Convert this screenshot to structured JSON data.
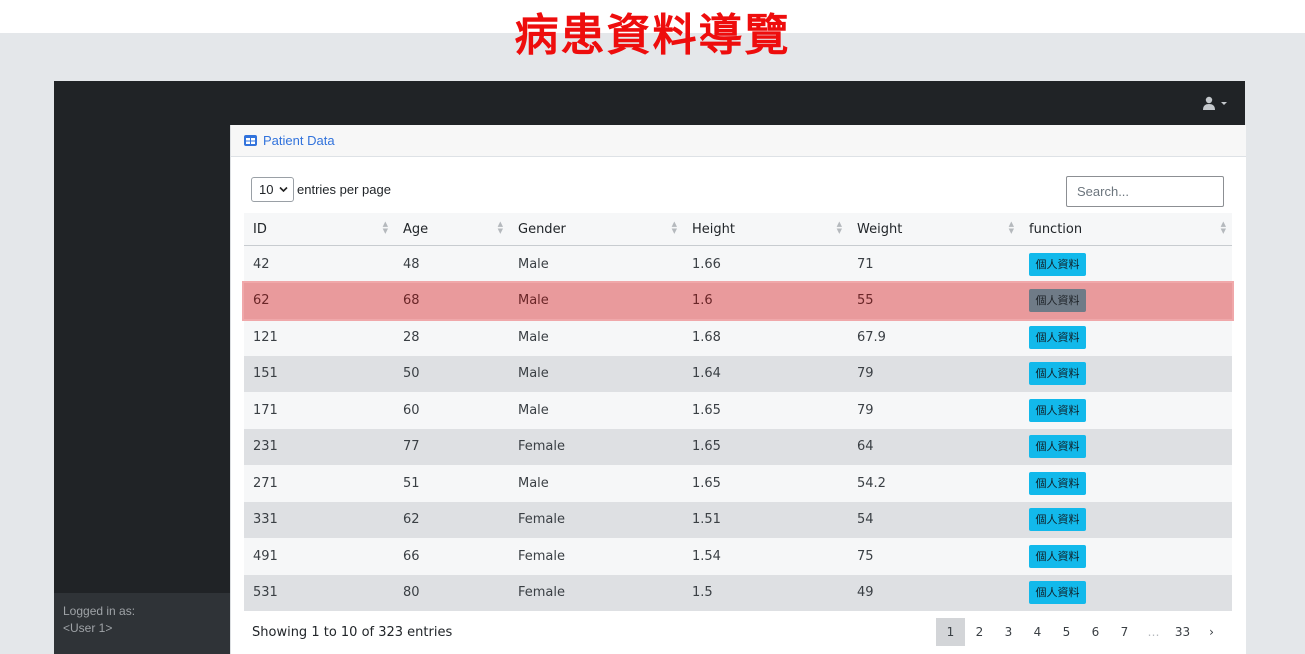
{
  "page_title": "病患資料導覽",
  "sidebar": {
    "logged_in_label": "Logged in as:",
    "user_name": "<User 1>"
  },
  "topnav": {
    "user_icon": "user-icon",
    "caret_icon": "caret-down-icon"
  },
  "card": {
    "title": "Patient Data",
    "icon": "table-icon"
  },
  "controls": {
    "page_length": "10",
    "page_length_label": "entries per page",
    "search_placeholder": "Search..."
  },
  "table": {
    "columns": [
      "ID",
      "Age",
      "Gender",
      "Height",
      "Weight",
      "function"
    ],
    "button_label": "個人資料",
    "rows": [
      {
        "id": "42",
        "age": "48",
        "gender": "Male",
        "height": "1.66",
        "weight": "71"
      },
      {
        "id": "62",
        "age": "68",
        "gender": "Male",
        "height": "1.6",
        "weight": "55"
      },
      {
        "id": "121",
        "age": "28",
        "gender": "Male",
        "height": "1.68",
        "weight": "67.9"
      },
      {
        "id": "151",
        "age": "50",
        "gender": "Male",
        "height": "1.64",
        "weight": "79"
      },
      {
        "id": "171",
        "age": "60",
        "gender": "Male",
        "height": "1.65",
        "weight": "79"
      },
      {
        "id": "231",
        "age": "77",
        "gender": "Female",
        "height": "1.65",
        "weight": "64"
      },
      {
        "id": "271",
        "age": "51",
        "gender": "Male",
        "height": "1.65",
        "weight": "54.2"
      },
      {
        "id": "331",
        "age": "62",
        "gender": "Female",
        "height": "1.51",
        "weight": "54"
      },
      {
        "id": "491",
        "age": "66",
        "gender": "Female",
        "height": "1.54",
        "weight": "75"
      },
      {
        "id": "531",
        "age": "80",
        "gender": "Female",
        "height": "1.5",
        "weight": "49"
      }
    ]
  },
  "footer": {
    "info": "Showing 1 to 10 of 323 entries",
    "pages": [
      "1",
      "2",
      "3",
      "4",
      "5",
      "6",
      "7",
      "…",
      "33",
      "›"
    ]
  },
  "colors": {
    "title_red": "#ee0d0d",
    "accent_blue": "#3273dc",
    "button_cyan": "#12b9eb",
    "highlight_row": "#e99a9c",
    "dark_nav": "#202326"
  }
}
